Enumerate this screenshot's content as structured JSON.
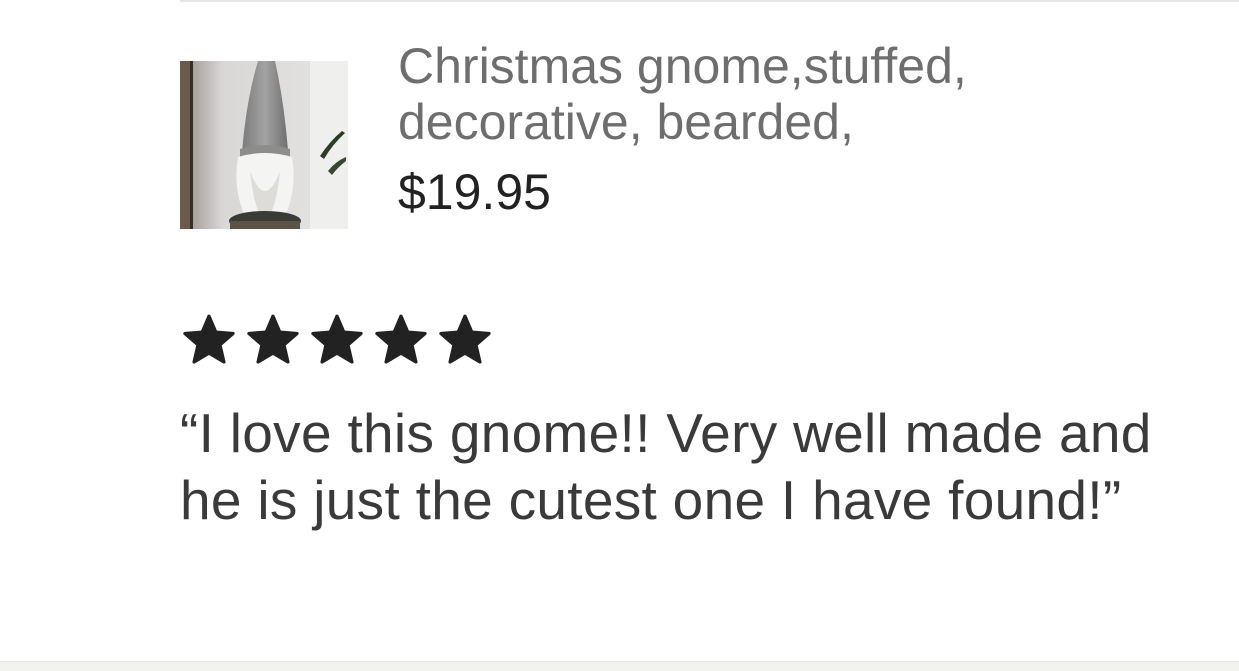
{
  "listing": {
    "title": "Christmas gnome,stuffed, decorative, bearded,",
    "price": "$19.95",
    "thumbnail_icon": "gnome-product-photo"
  },
  "review": {
    "rating": 5,
    "rating_max": 5,
    "text": "“I love this gnome!!  Very well made and he is just the cutest one I have found!”"
  },
  "colors": {
    "title": "#6e6e6e",
    "price": "#222222",
    "review_text": "#3a3a3a",
    "star": "#222222",
    "divider": "#e5e5e5"
  }
}
